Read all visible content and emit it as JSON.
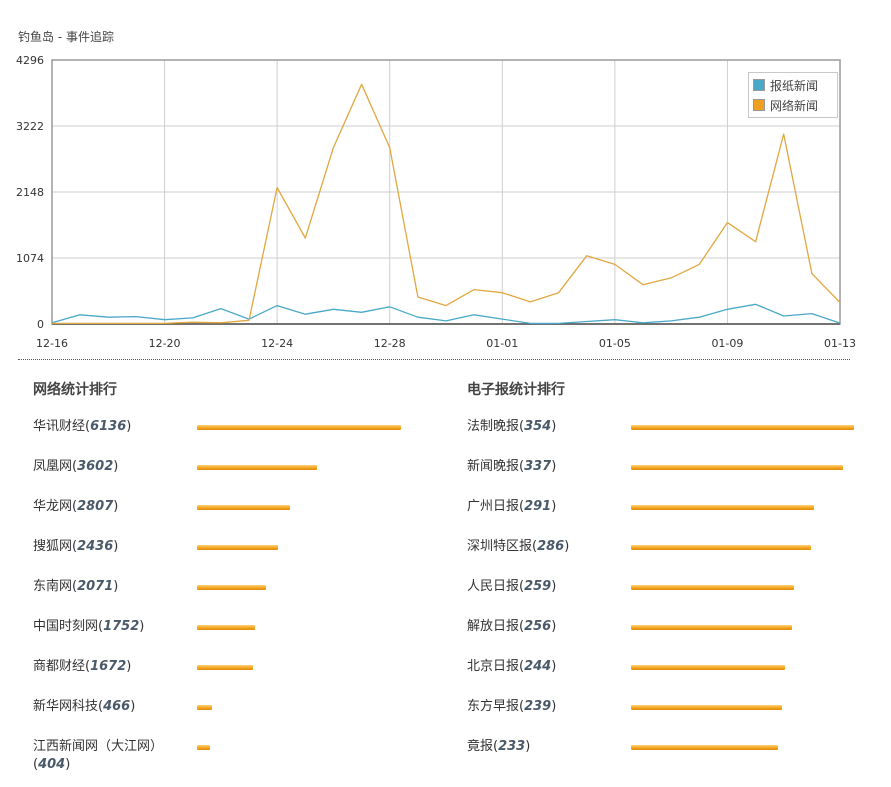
{
  "page": {
    "title": "钓鱼岛 - 事件追踪"
  },
  "chart_data": {
    "type": "line",
    "x": [
      "12-16",
      "12-17",
      "12-18",
      "12-19",
      "12-20",
      "12-21",
      "12-22",
      "12-23",
      "12-24",
      "12-25",
      "12-26",
      "12-27",
      "12-28",
      "12-29",
      "12-30",
      "12-31",
      "01-01",
      "01-02",
      "01-03",
      "01-04",
      "01-05",
      "01-06",
      "01-07",
      "01-08",
      "01-09",
      "01-10",
      "01-11",
      "01-12",
      "01-13"
    ],
    "x_tick_labels": [
      "12-16",
      "12-20",
      "12-24",
      "12-28",
      "01-01",
      "01-05",
      "01-09",
      "01-13"
    ],
    "y_tick_labels": [
      "4296",
      "3222",
      "2148",
      "1074",
      "0"
    ],
    "ylim": [
      0,
      4296
    ],
    "grid": true,
    "legend_position": "top-right",
    "series": [
      {
        "name": "报纸新闻",
        "color": "#4aa8c8",
        "values": [
          20,
          150,
          110,
          120,
          70,
          100,
          250,
          80,
          300,
          160,
          240,
          190,
          280,
          110,
          50,
          150,
          80,
          10,
          10,
          40,
          70,
          20,
          50,
          110,
          240,
          320,
          130,
          170,
          15
        ]
      },
      {
        "name": "网络新闻",
        "color": "#e0a840",
        "values": [
          10,
          10,
          10,
          10,
          10,
          30,
          20,
          60,
          2220,
          1400,
          2870,
          3900,
          2870,
          440,
          300,
          560,
          510,
          360,
          510,
          1110,
          970,
          640,
          750,
          970,
          1650,
          1340,
          3090,
          820,
          350
        ]
      }
    ]
  },
  "web_ranking": {
    "title": "网络统计排行",
    "items": [
      {
        "name": "华讯财经",
        "count": "6136",
        "value": 6136
      },
      {
        "name": "凤凰网",
        "count": "3602",
        "value": 3602
      },
      {
        "name": "华龙网",
        "count": "2807",
        "value": 2807
      },
      {
        "name": "搜狐网",
        "count": "2436",
        "value": 2436
      },
      {
        "name": "东南网",
        "count": "2071",
        "value": 2071
      },
      {
        "name": "中国时刻网",
        "count": "1752",
        "value": 1752
      },
      {
        "name": "商都财经",
        "count": "1672",
        "value": 1672
      },
      {
        "name": "新华网科技",
        "count": "466",
        "value": 466
      },
      {
        "name": "江西新闻网（大江网）",
        "count": "404",
        "value": 404
      }
    ]
  },
  "paper_ranking": {
    "title": "电子报统计排行",
    "items": [
      {
        "name": "法制晚报",
        "count": "354",
        "value": 354
      },
      {
        "name": "新闻晚报",
        "count": "337",
        "value": 337
      },
      {
        "name": "广州日报",
        "count": "291",
        "value": 291
      },
      {
        "name": "深圳特区报",
        "count": "286",
        "value": 286
      },
      {
        "name": "人民日报",
        "count": "259",
        "value": 259
      },
      {
        "name": "解放日报",
        "count": "256",
        "value": 256
      },
      {
        "name": "北京日报",
        "count": "244",
        "value": 244
      },
      {
        "name": "东方早报",
        "count": "239",
        "value": 239
      },
      {
        "name": "竟报",
        "count": "233",
        "value": 233
      }
    ]
  }
}
